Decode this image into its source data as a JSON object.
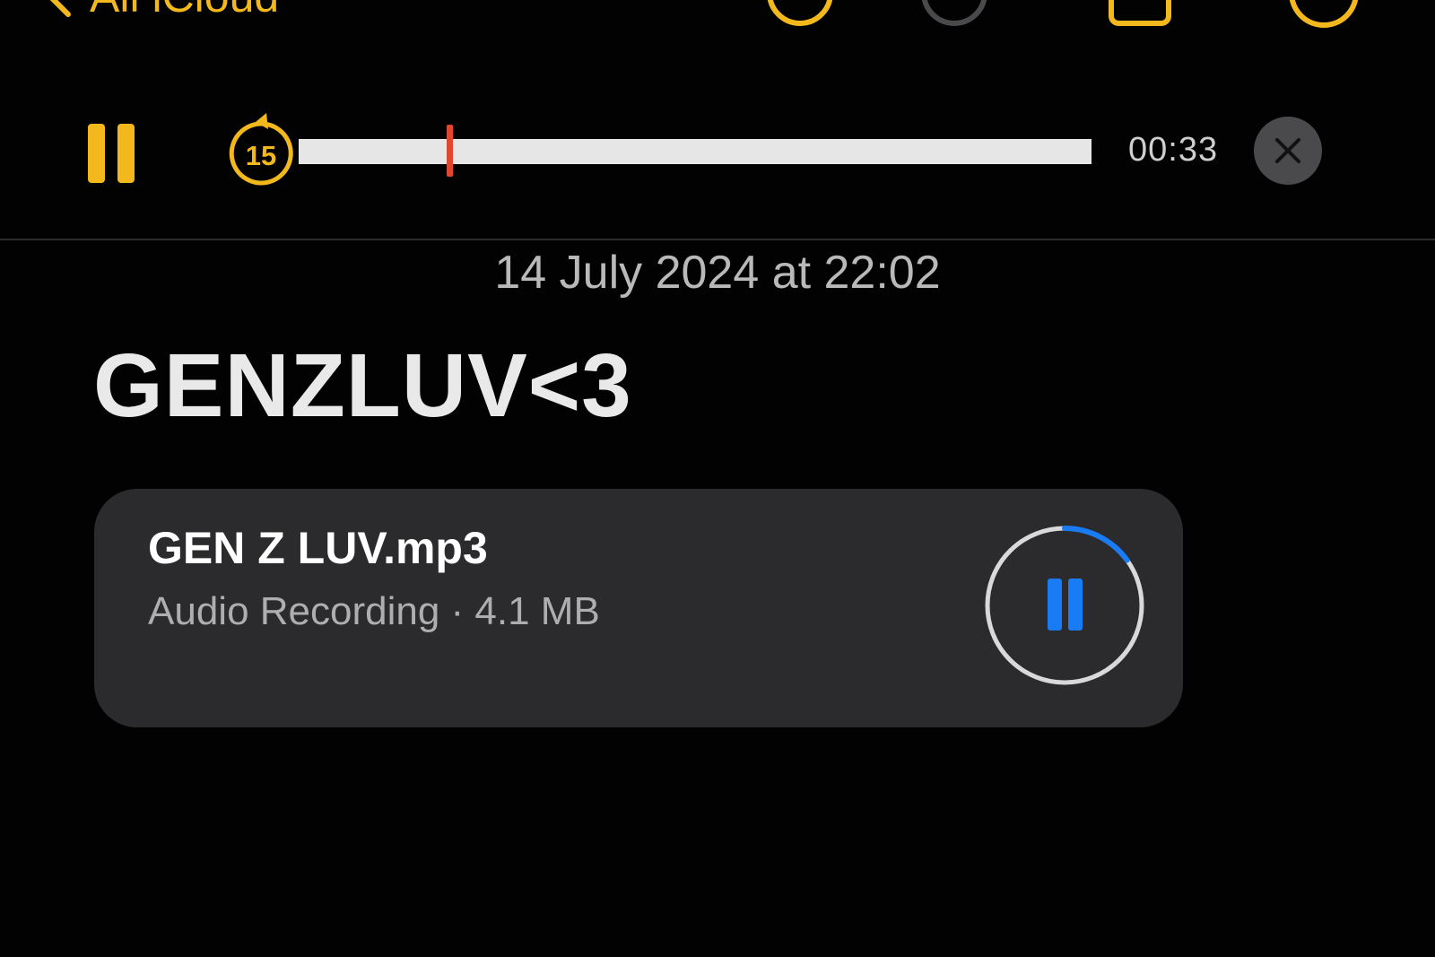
{
  "nav": {
    "back_label": "All iCloud",
    "icons": [
      "back-chevron-icon",
      "checklist-icon",
      "markup-icon",
      "share-icon",
      "more-icon"
    ]
  },
  "player": {
    "pause_icon": "pause-icon",
    "skip_back_label": "15",
    "progress": 0.19,
    "time_remaining": "00:33",
    "close_icon": "close-icon"
  },
  "note": {
    "date": "14 July 2024 at 22:02",
    "title": "GENZLUV<3"
  },
  "attachment": {
    "file_name": "GEN Z LUV.mp3",
    "meta": "Audio Recording · 4.1 MB",
    "playback_progress": 0.15,
    "control_icon": "pause-icon"
  },
  "colors": {
    "background": "#020202",
    "accent": "#f2b81c",
    "playhead": "#e0472f",
    "card": "#2b2b2d",
    "audio_control": "#1a7cf5"
  }
}
